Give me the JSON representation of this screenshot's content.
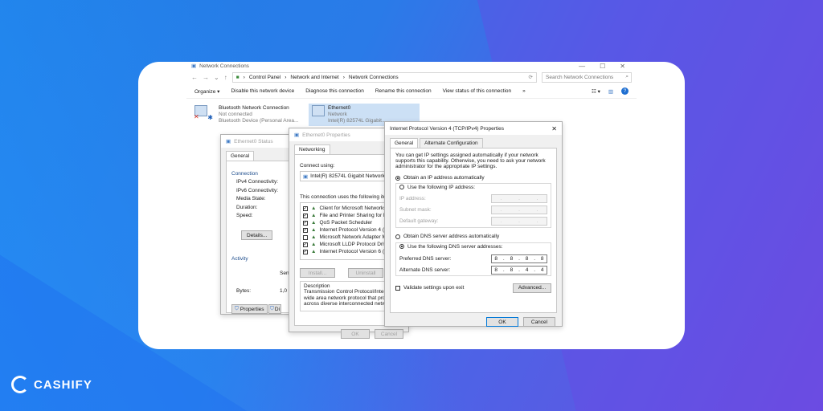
{
  "explorer": {
    "title": "Network Connections",
    "breadcrumb": [
      "Control Panel",
      "Network and Internet",
      "Network Connections"
    ],
    "search_placeholder": "Search Network Connections",
    "toolbar": [
      "Organize ▾",
      "Disable this network device",
      "Diagnose this connection",
      "Rename this connection",
      "View status of this connection",
      "»"
    ],
    "connections": [
      {
        "name": "Bluetooth Network Connection",
        "status": "Not connected",
        "device": "Bluetooth Device (Personal Area..."
      },
      {
        "name": "Ethernet0",
        "status": "Network",
        "device": "Intel(R) 82574L Gigabit..."
      }
    ]
  },
  "status_dialog": {
    "title": "Ethernet0 Status",
    "tab": "General",
    "connection_label": "Connection",
    "rows": [
      "IPv4 Connectivity:",
      "IPv6 Connectivity:",
      "Media State:",
      "Duration:",
      "Speed:"
    ],
    "details_button": "Details...",
    "activity_label": "Activity",
    "sent": "Sen",
    "bytes_label": "Bytes:",
    "bytes_value": "1,0",
    "properties_button": "Properties",
    "disable_button": "Di"
  },
  "props_dialog": {
    "title": "Ethernet0 Properties",
    "tab": "Networking",
    "connect_using": "Connect using:",
    "adapter": "Intel(R) 82574L Gigabit Network C",
    "items_label": "This connection uses the following items:",
    "items": [
      {
        "label": "Client for Microsoft Networks",
        "checked": true
      },
      {
        "label": "File and Printer Sharing for Micro",
        "checked": true
      },
      {
        "label": "QoS Packet Scheduler",
        "checked": true
      },
      {
        "label": "Internet Protocol Version 4 (TCP",
        "checked": true
      },
      {
        "label": "Microsoft Network Adapter Mult",
        "checked": false
      },
      {
        "label": "Microsoft LLDP Protocol Driver",
        "checked": true
      },
      {
        "label": "Internet Protocol Version 6 (TCP",
        "checked": true
      }
    ],
    "install_button": "Install...",
    "uninstall_button": "Uninstall",
    "description_label": "Description",
    "description": "Transmission Control Protocol/Internet wide area network protocol that provid across diverse interconnected netwo",
    "ok_button": "OK",
    "cancel_button": "Cancel"
  },
  "ipv4_dialog": {
    "title": "Internet Protocol Version 4 (TCP/IPv4) Properties",
    "tabs": [
      "General",
      "Alternate Configuration"
    ],
    "intro": "You can get IP settings assigned automatically if your network supports this capability. Otherwise, you need to ask your network administrator for the appropriate IP settings.",
    "obtain_ip": "Obtain an IP address automatically",
    "use_ip": "Use the following IP address:",
    "ip_address": "IP address:",
    "subnet": "Subnet mask:",
    "gateway": "Default gateway:",
    "obtain_dns": "Obtain DNS server address automatically",
    "use_dns": "Use the following DNS server addresses:",
    "preferred_dns": "Preferred DNS server:",
    "preferred_value": [
      "8",
      "8",
      "8",
      "8"
    ],
    "alternate_dns": "Alternate DNS server:",
    "alternate_value": [
      "8",
      "8",
      "4",
      "4"
    ],
    "validate": "Validate settings upon exit",
    "advanced_button": "Advanced...",
    "ok_button": "OK",
    "cancel_button": "Cancel"
  },
  "brand": "CASHIFY"
}
